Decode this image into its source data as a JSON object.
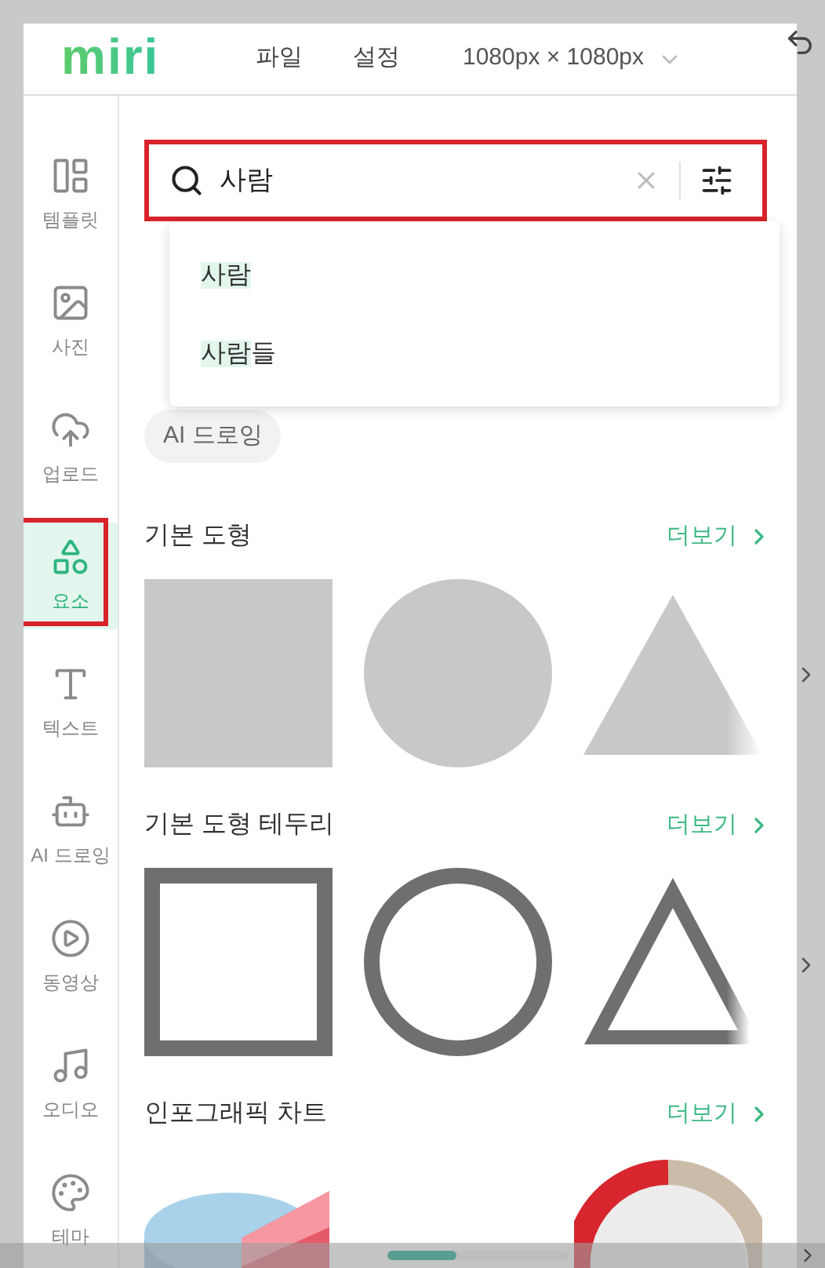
{
  "header": {
    "logo": "miri",
    "menu": [
      "파일",
      "설정"
    ],
    "canvas_size": "1080px × 1080px"
  },
  "sidebar": {
    "items": [
      {
        "label": "템플릿",
        "selected": false
      },
      {
        "label": "사진",
        "selected": false
      },
      {
        "label": "업로드",
        "selected": false
      },
      {
        "label": "요소",
        "selected": true
      },
      {
        "label": "텍스트",
        "selected": false
      },
      {
        "label": "AI 드로잉",
        "selected": false
      },
      {
        "label": "동영상",
        "selected": false
      },
      {
        "label": "오디오",
        "selected": false
      },
      {
        "label": "테마",
        "selected": false
      }
    ]
  },
  "search": {
    "value": "사람"
  },
  "suggestions": [
    {
      "match": "사람"
    },
    {
      "match": "사람",
      "rest": "들"
    }
  ],
  "chips": [
    "AI 드로잉"
  ],
  "sections": [
    {
      "title": "기본 도형",
      "more": "더보기",
      "items": [
        {
          "kind": "square-fill"
        },
        {
          "kind": "circle-fill"
        },
        {
          "kind": "triangle-fill"
        }
      ]
    },
    {
      "title": "기본 도형 테두리",
      "more": "더보기",
      "items": [
        {
          "kind": "square-outline"
        },
        {
          "kind": "circle-outline"
        },
        {
          "kind": "triangle-outline"
        }
      ]
    },
    {
      "title": "인포그래픽 차트",
      "more": "더보기",
      "items": [
        {
          "kind": "pie-chart"
        },
        {
          "kind": "donut-chart"
        }
      ]
    }
  ]
}
